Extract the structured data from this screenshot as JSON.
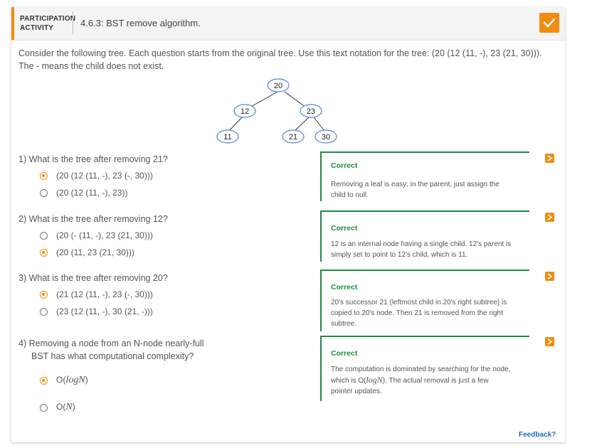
{
  "header": {
    "tag": "PARTICIPATION ACTIVITY",
    "title": "4.6.3: BST remove algorithm."
  },
  "intro": "Consider the following tree. Each question starts from the original tree. Use this text notation for the tree: (20 (12 (11, -), 23 (21, 30))). The - means the child does not exist.",
  "tree": {
    "nodes": [
      "20",
      "12",
      "23",
      "11",
      "21",
      "30"
    ]
  },
  "questions": [
    {
      "prompt": "1) What is the tree after removing 21?",
      "options": [
        "(20 (12 (11, -), 23 (-, 30)))",
        "(20 (12 (11, -), 23))"
      ],
      "selected": 0,
      "feedback_title": "Correct",
      "feedback_lines": [
        "Removing a leaf is easy; in the parent, just assign the",
        "child to null."
      ]
    },
    {
      "prompt": "2) What is the tree after removing 12?",
      "options": [
        "(20 (- (11, -), 23 (21, 30)))",
        "(20 (11, 23 (21, 30)))"
      ],
      "selected": 1,
      "feedback_title": "Correct",
      "feedback_lines": [
        "12 is an internal node having a single child. 12's parent is",
        "simply set to point to 12's child, which is 11."
      ]
    },
    {
      "prompt": "3) What is the tree after removing 20?",
      "options": [
        "(21 (12 (11, -), 23 (-, 30)))",
        "(23 (12 (11, -), 30 (21, -)))"
      ],
      "selected": 0,
      "feedback_title": "Correct",
      "feedback_lines": [
        "20's successor 21 (leftmost child in 20's right subtree) is",
        "copied to 20's node. Then 21 is removed from the right",
        "subtree."
      ]
    },
    {
      "prompt_lines": [
        "4) Removing a node from an N-node nearly-full",
        "BST has what computational complexity?"
      ],
      "options": [
        {
          "prefix": "O(",
          "math": "logN",
          "suffix": ")"
        },
        {
          "prefix": "O(",
          "math": "N",
          "suffix": ")"
        }
      ],
      "selected": 0,
      "feedback_title": "Correct",
      "feedback_lines": [
        "The computation is dominated by searching for the node,",
        "which is O(",
        "logN",
        "). The actual removal is just a few",
        "pointer updates."
      ]
    }
  ],
  "feedback_link": "Feedback?",
  "colors": {
    "accent": "#f28c0f",
    "correct": "#1e8e3e",
    "link": "#2a6bbd",
    "node_border": "#4a8ad8"
  },
  "icons": {
    "done": "checkmark-icon",
    "question_status": "chevron-right-icon"
  }
}
